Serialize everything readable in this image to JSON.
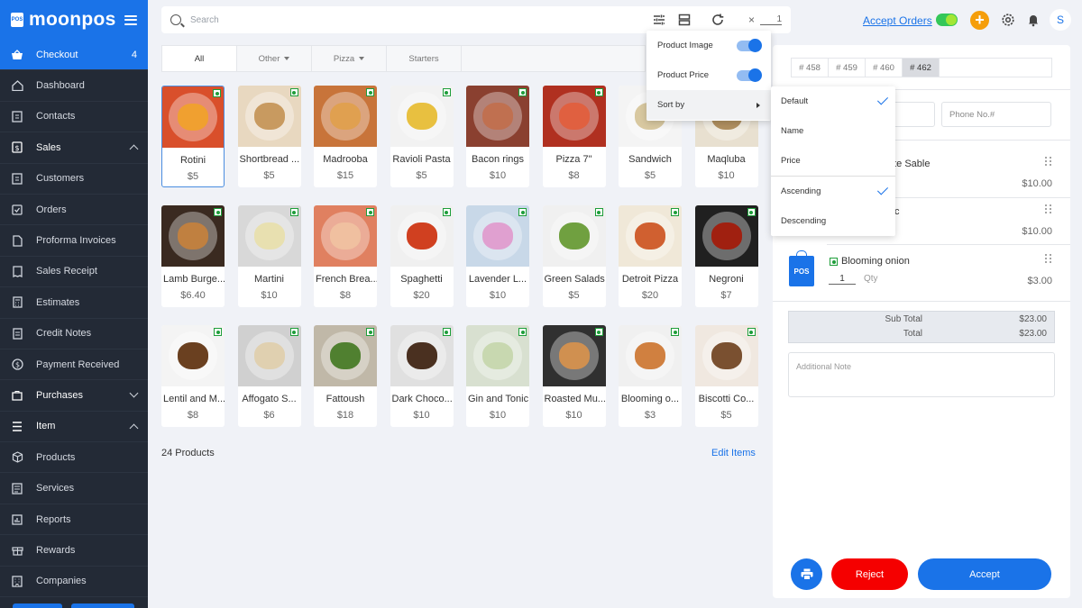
{
  "app": {
    "logo_text": "moonpos",
    "logo_badge": "POS"
  },
  "sidebar": {
    "items": [
      {
        "label": "Checkout",
        "badge": "4",
        "icon": "basket-icon"
      },
      {
        "label": "Dashboard",
        "icon": "home-icon"
      },
      {
        "label": "Contacts",
        "icon": "contacts-icon"
      },
      {
        "label": "Sales",
        "icon": "dollar-icon"
      },
      {
        "label": "Customers",
        "icon": "customers-icon"
      },
      {
        "label": "Orders",
        "icon": "check-square-icon"
      },
      {
        "label": "Proforma Invoices",
        "icon": "document-icon"
      },
      {
        "label": "Sales Receipt",
        "icon": "receipt-icon"
      },
      {
        "label": "Estimates",
        "icon": "calculator-icon"
      },
      {
        "label": "Credit Notes",
        "icon": "notes-icon"
      },
      {
        "label": "Payment Received",
        "icon": "payment-icon"
      },
      {
        "label": "Purchases",
        "icon": "bag-icon"
      },
      {
        "label": "Item",
        "icon": "list-icon"
      },
      {
        "label": "Products",
        "icon": "box-icon"
      },
      {
        "label": "Services",
        "icon": "services-icon"
      },
      {
        "label": "Reports",
        "icon": "chart-icon"
      },
      {
        "label": "Rewards",
        "icon": "gift-icon"
      },
      {
        "label": "Companies",
        "icon": "building-icon"
      }
    ]
  },
  "topbar": {
    "search_placeholder": "Search",
    "clear_glyph": "×",
    "quantity": "1",
    "accept_orders_label": "Accept Orders",
    "plus_glyph": "+",
    "avatar_initial": "S"
  },
  "categories": {
    "tabs": [
      {
        "label": "All"
      },
      {
        "label": "Other"
      },
      {
        "label": "Pizza"
      },
      {
        "label": "Starters"
      }
    ]
  },
  "products": {
    "items": [
      {
        "name": "Rotini",
        "price": "$5"
      },
      {
        "name": "Shortbread ...",
        "price": "$5"
      },
      {
        "name": "Madrooba",
        "price": "$15"
      },
      {
        "name": "Ravioli Pasta",
        "price": "$5"
      },
      {
        "name": "Bacon rings",
        "price": "$10"
      },
      {
        "name": "Pizza 7\"",
        "price": "$8"
      },
      {
        "name": "Sandwich",
        "price": "$5"
      },
      {
        "name": "Maqluba",
        "price": "$10"
      },
      {
        "name": "Lamb Burge...",
        "price": "$6.40"
      },
      {
        "name": "Martini",
        "price": "$10"
      },
      {
        "name": "French Brea...",
        "price": "$8"
      },
      {
        "name": "Spaghetti",
        "price": "$20"
      },
      {
        "name": "Lavender L...",
        "price": "$10"
      },
      {
        "name": "Green Salads",
        "price": "$5"
      },
      {
        "name": "Detroit Pizza",
        "price": "$20"
      },
      {
        "name": "Negroni",
        "price": "$7"
      },
      {
        "name": "Lentil and M...",
        "price": "$8"
      },
      {
        "name": "Affogato S...",
        "price": "$6"
      },
      {
        "name": "Fattoush",
        "price": "$18"
      },
      {
        "name": "Dark Choco...",
        "price": "$10"
      },
      {
        "name": "Gin and Tonic",
        "price": "$10"
      },
      {
        "name": "Roasted Mu...",
        "price": "$10"
      },
      {
        "name": "Blooming o...",
        "price": "$3"
      },
      {
        "name": "Biscotti Co...",
        "price": "$5"
      }
    ],
    "count_label": "24 Products",
    "edit_label": "Edit Items"
  },
  "settings_menu": {
    "product_image_label": "Product Image",
    "product_price_label": "Product Price",
    "sort_by_label": "Sort by"
  },
  "sort_menu": {
    "default_label": "Default",
    "name_label": "Name",
    "price_label": "Price",
    "ascending_label": "Ascending",
    "descending_label": "Descending"
  },
  "order_panel": {
    "order_tabs": [
      "# 458",
      "# 459",
      "# 460",
      "# 462"
    ],
    "phone_placeholder": "Phone No.#",
    "line_items": [
      {
        "name_visible": "ate Sable",
        "price": "$10.00"
      },
      {
        "name_visible": "c",
        "price": "$10.00"
      },
      {
        "name_visible": "Blooming onion",
        "qty": "1",
        "qty_label": "Qty",
        "price": "$3.00"
      }
    ],
    "pos_badge": "POS",
    "sub_total_label": "Sub Total",
    "sub_total_value": "$23.00",
    "total_label": "Total",
    "total_value": "$23.00",
    "note_placeholder": "Additional Note",
    "reject_label": "Reject",
    "accept_label": "Accept"
  }
}
